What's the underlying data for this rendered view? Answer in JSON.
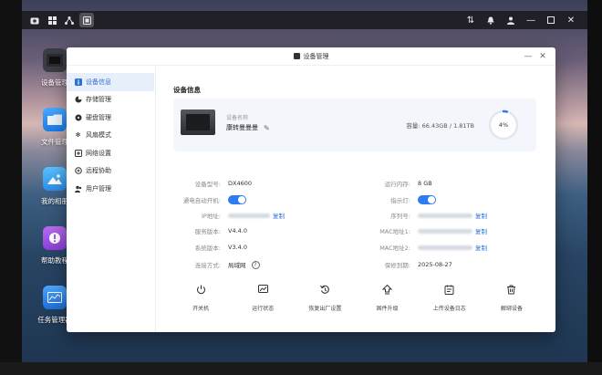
{
  "window": {
    "title": "设备管理"
  },
  "desktop": {
    "icons": [
      {
        "label": "设备管理"
      },
      {
        "label": "文件管理"
      },
      {
        "label": "我的相册"
      },
      {
        "label": "帮助教程"
      },
      {
        "label": "任务管理器"
      }
    ]
  },
  "sidebar": {
    "items": [
      {
        "label": "设备信息",
        "icon": "info-icon",
        "active": true
      },
      {
        "label": "存储管理",
        "icon": "pie-icon"
      },
      {
        "label": "硬盘管理",
        "icon": "disk-icon"
      },
      {
        "label": "风扇模式",
        "icon": "fan-icon"
      },
      {
        "label": "网络设置",
        "icon": "network-icon"
      },
      {
        "label": "远程协助",
        "icon": "remote-icon"
      },
      {
        "label": "用户管理",
        "icon": "users-icon"
      }
    ]
  },
  "main": {
    "section_title": "设备信息",
    "device": {
      "name_label": "设备名称",
      "name": "康转曼曼曼",
      "capacity": "容量: 66.43GB / 1.81TB",
      "usage_percent": "4%",
      "usage_fraction": 0.04
    },
    "left_fields": [
      {
        "label": "设备型号:",
        "value": "DX4600"
      },
      {
        "label": "通电自动开机:",
        "toggle": true
      },
      {
        "label": "IP地址:",
        "value": "复制"
      },
      {
        "label": "服务版本:",
        "value": "V4.4.0"
      },
      {
        "label": "系统版本:",
        "value": "V3.4.0"
      },
      {
        "label": "连接方式:",
        "value": "局域网"
      }
    ],
    "right_fields": [
      {
        "label": "运行内存:",
        "value": "8 GB"
      },
      {
        "label": "指示灯:",
        "toggle": true
      },
      {
        "label": "序列号:",
        "value": "复制"
      },
      {
        "label": "MAC地址1:",
        "value": "复制"
      },
      {
        "label": "MAC地址2:",
        "value": "复制"
      },
      {
        "label": "保修到期:",
        "value": "2025-08-27"
      }
    ],
    "actions": [
      {
        "label": "开关机",
        "icon": "power-icon"
      },
      {
        "label": "运行状态",
        "icon": "monitor-icon"
      },
      {
        "label": "恢复出厂设置",
        "icon": "reset-icon"
      },
      {
        "label": "固件升级",
        "icon": "upgrade-icon"
      },
      {
        "label": "上传设备日志",
        "icon": "log-icon"
      },
      {
        "label": "解绑设备",
        "icon": "trash-icon"
      }
    ]
  },
  "colors": {
    "accent": "#2f7cf0",
    "active_bg": "#e6effa"
  }
}
